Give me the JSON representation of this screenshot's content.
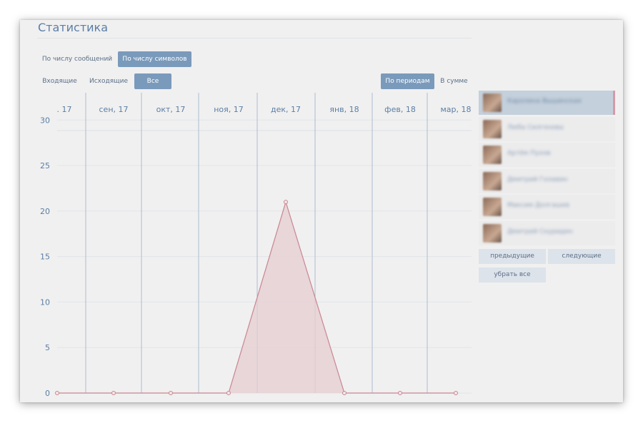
{
  "title": "Статистика",
  "mode_tabs": [
    "По числу сообщений",
    "По числу символов"
  ],
  "mode_active": 1,
  "direction_tabs": [
    "Входящие",
    "Исходящие",
    "Все"
  ],
  "direction_active": 2,
  "aggregation_tabs": [
    "По периодам",
    "В сумме"
  ],
  "aggregation_active": 0,
  "friends": [
    {
      "name": "Каролина Вышинская",
      "selected": true
    },
    {
      "name": "Люба Силгенова",
      "selected": false
    },
    {
      "name": "Артём Пухов",
      "selected": false
    },
    {
      "name": "Дмитрий Голавин",
      "selected": false
    },
    {
      "name": "Максим Долгашев",
      "selected": false
    },
    {
      "name": "Дмитрий Скуридин",
      "selected": false
    }
  ],
  "pager": {
    "prev_label": "предыдущие",
    "next_label": "следующие",
    "clear_label": "убрать все"
  },
  "colors": {
    "accent": "#7a9abb",
    "series": "#c98592",
    "area": "#e6cdd2",
    "title": "#5b7ea6"
  },
  "chart_data": {
    "type": "area",
    "categories": [
      ". 17",
      "сен, 17",
      "окт, 17",
      "ноя, 17",
      "дек, 17",
      "янв, 18",
      "фев, 18",
      "мар, 18"
    ],
    "series": [
      {
        "values": [
          0,
          0,
          0,
          0,
          21,
          0,
          0,
          0
        ]
      }
    ],
    "yticks": [
      0,
      5,
      10,
      15,
      20,
      25,
      30
    ],
    "ylim": [
      0,
      33
    ],
    "grid": true
  }
}
